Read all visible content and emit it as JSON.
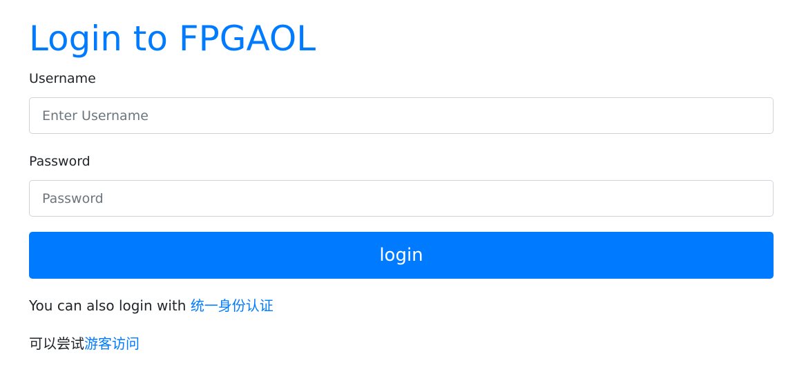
{
  "page": {
    "title": "Login to FPGAOL"
  },
  "form": {
    "username_label": "Username",
    "username_placeholder": "Enter Username",
    "username_value": "",
    "password_label": "Password",
    "password_placeholder": "Password",
    "password_value": "",
    "submit_label": "login"
  },
  "alt_login": {
    "prefix": "You can also login with ",
    "link_label": "统一身份认证"
  },
  "guest": {
    "prefix": "可以尝试",
    "link_label": "游客访问"
  },
  "colors": {
    "primary": "#007bff",
    "text": "#212529",
    "input_border": "#ced4da",
    "placeholder": "#6c757d",
    "background": "#ffffff"
  }
}
